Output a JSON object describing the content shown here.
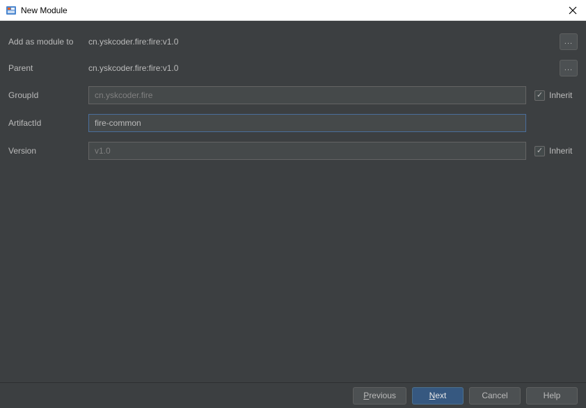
{
  "window": {
    "title": "New Module"
  },
  "form": {
    "add_module_label": "Add as module to",
    "add_module_value": "cn.yskcoder.fire:fire:v1.0",
    "parent_label": "Parent",
    "parent_value": "cn.yskcoder.fire:fire:v1.0",
    "groupid_label": "GroupId",
    "groupid_value": "cn.yskcoder.fire",
    "artifactid_label": "ArtifactId",
    "artifactid_value": "fire-common",
    "version_label": "Version",
    "version_value": "v1.0",
    "inherit_label": "Inherit",
    "browse_label": "..."
  },
  "buttons": {
    "previous": "Previous",
    "next": "Next",
    "cancel": "Cancel",
    "help": "Help"
  }
}
